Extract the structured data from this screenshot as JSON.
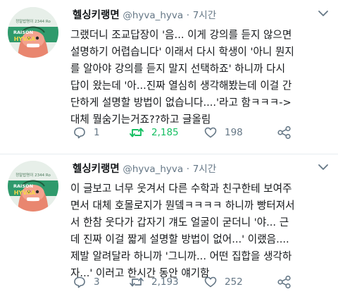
{
  "tweets": [
    {
      "name": "헬싱키랭면",
      "handle": "@hyva_hyva",
      "separator": "·",
      "time": "7시간",
      "lines": [
        "그랬더니 조교답장이 '음... 이게 강의를 듣지 않으면",
        "설명하기 어렵습니다' 이래서 다시 학생이 '아니 뭔지",
        "를 알아야 강의를 듣지 말지 선택하죠' 하니까 다시",
        "답이 왔는데 '아...진짜 열심히 생각해봤는데 이걸 간",
        "단하게 설명할 방법이 없습니다....'라고 함ㅋㅋㅋ->",
        "대체 뭘숨기는거죠??하고 글올림"
      ],
      "reply_count": "1",
      "retweet_count": "2,185",
      "like_count": "198",
      "retweeted": true
    },
    {
      "name": "헬싱키랭면",
      "handle": "@hyva_hyva",
      "separator": "·",
      "time": "7시간",
      "lines": [
        "이 글보고 너무 웃겨서 다른 수학과 친구한테 보여주",
        "면서 대체 호몰로지가 뭔뎈ㅋㅋㅋㅋ 하니까 빵터져서",
        "서 한참 웃다가 갑자기 걔도 얼굴이 굳더니 '야... 근",
        "데 진짜 이걸 짧게 설명할 방법이 없어...' 이랬음....",
        "제발 알려달라 하니까 '그니까... 어떤 집합을 생각하",
        "자...' 이러고 한시간 동안 얘기함"
      ],
      "reply_count": "3",
      "retweet_count": "2,193",
      "like_count": "252",
      "retweeted": false
    }
  ],
  "avatar": {
    "top_text": "정말밥명이 2344 Ro",
    "mid_text": "RAISON",
    "bottom_text": "HYVAA"
  },
  "colors": {
    "text": "#14171a",
    "muted": "#657786",
    "retweet_active": "#17bf63",
    "divider": "#e6ecf0"
  }
}
